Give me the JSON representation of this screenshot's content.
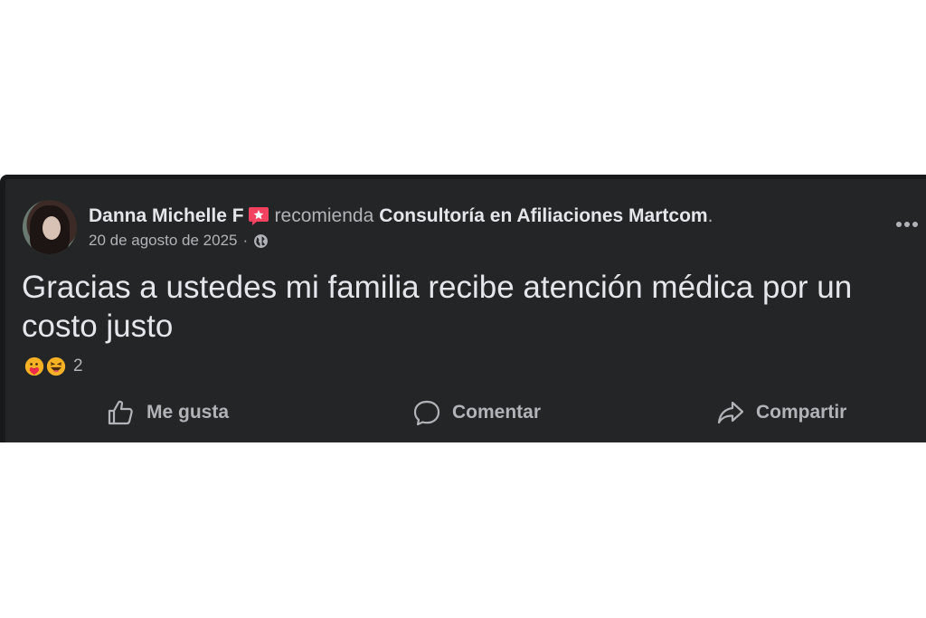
{
  "post": {
    "author": "Danna Michelle F",
    "recommends_text": "recomienda",
    "page_name": "Consultoría en Afiliaciones Martcom",
    "period": ".",
    "date": "20 de agosto de 2025",
    "separator": "·",
    "audience_icon": "globe-icon",
    "body": "Gracias a ustedes mi familia recibe atención médica por un costo justo",
    "reactions": {
      "icons": [
        "care-reaction-icon",
        "haha-reaction-icon"
      ],
      "count": "2"
    }
  },
  "actions": {
    "like_label": "Me gusta",
    "comment_label": "Comentar",
    "share_label": "Compartir"
  },
  "colors": {
    "card_bg": "#242526",
    "primary_text": "#e4e6eb",
    "secondary_text": "#b0b3b8",
    "recommend_badge": "#f3425f"
  }
}
